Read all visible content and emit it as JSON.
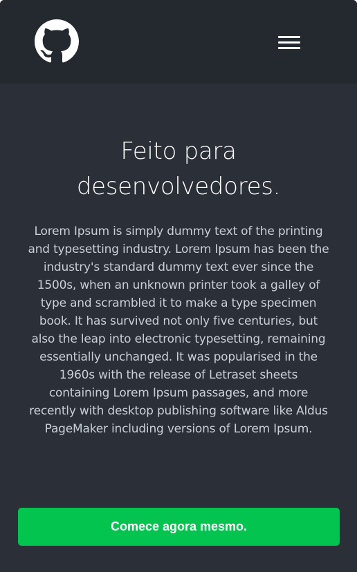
{
  "header": {
    "logo_icon": "github-icon",
    "menu_icon": "hamburger-menu-icon"
  },
  "hero": {
    "title": "Feito para desenvolvedores.",
    "text": "Lorem Ipsum is simply dummy text of the printing and typesetting industry. Lorem Ipsum has been the industry's standard dummy text ever since the 1500s, when an unknown printer took a galley of type and scrambled it to make a type specimen book. It has survived not only five centuries, but also the leap into electronic typesetting, remaining essentially unchanged. It was popularised in the 1960s with the release of Letraset sheets containing Lorem Ipsum passages, and more recently with desktop publishing software like Aldus PageMaker including versions of Lorem Ipsum.",
    "cta_label": "Comece agora mesmo."
  },
  "colors": {
    "header_bg": "#24292f",
    "page_bg": "#2b3038",
    "accent": "#02c44f",
    "text_muted": "#c9ced6"
  }
}
